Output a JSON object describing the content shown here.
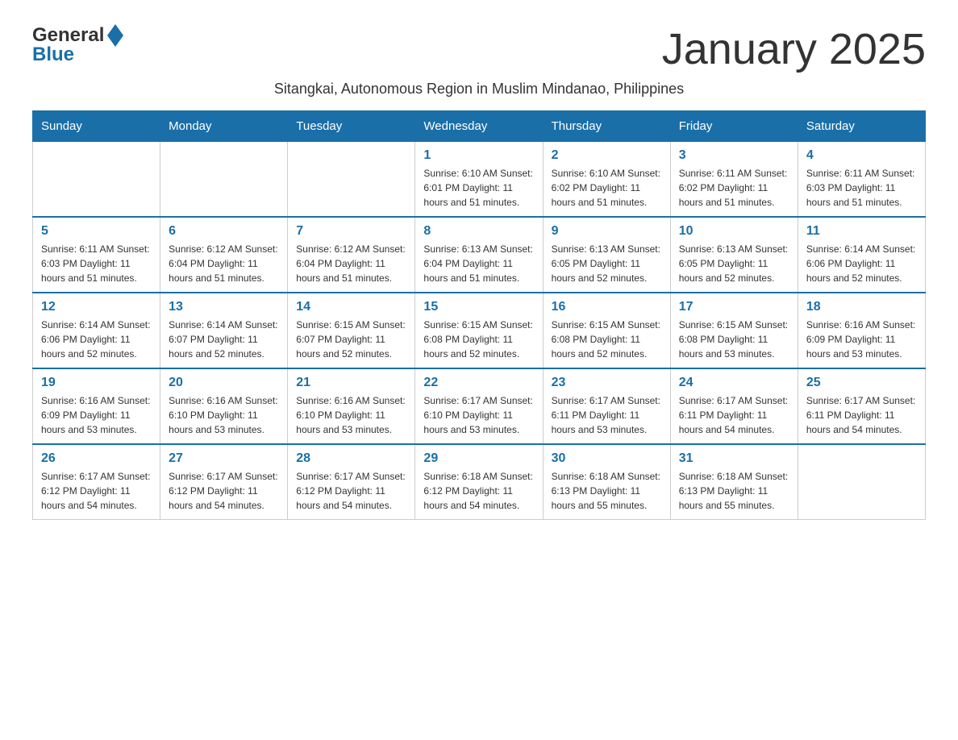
{
  "header": {
    "logo_general": "General",
    "logo_blue": "Blue",
    "month_title": "January 2025",
    "subtitle": "Sitangkai, Autonomous Region in Muslim Mindanao, Philippines"
  },
  "days_of_week": [
    "Sunday",
    "Monday",
    "Tuesday",
    "Wednesday",
    "Thursday",
    "Friday",
    "Saturday"
  ],
  "weeks": [
    [
      {
        "day": "",
        "info": ""
      },
      {
        "day": "",
        "info": ""
      },
      {
        "day": "",
        "info": ""
      },
      {
        "day": "1",
        "info": "Sunrise: 6:10 AM\nSunset: 6:01 PM\nDaylight: 11 hours and 51 minutes."
      },
      {
        "day": "2",
        "info": "Sunrise: 6:10 AM\nSunset: 6:02 PM\nDaylight: 11 hours and 51 minutes."
      },
      {
        "day": "3",
        "info": "Sunrise: 6:11 AM\nSunset: 6:02 PM\nDaylight: 11 hours and 51 minutes."
      },
      {
        "day": "4",
        "info": "Sunrise: 6:11 AM\nSunset: 6:03 PM\nDaylight: 11 hours and 51 minutes."
      }
    ],
    [
      {
        "day": "5",
        "info": "Sunrise: 6:11 AM\nSunset: 6:03 PM\nDaylight: 11 hours and 51 minutes."
      },
      {
        "day": "6",
        "info": "Sunrise: 6:12 AM\nSunset: 6:04 PM\nDaylight: 11 hours and 51 minutes."
      },
      {
        "day": "7",
        "info": "Sunrise: 6:12 AM\nSunset: 6:04 PM\nDaylight: 11 hours and 51 minutes."
      },
      {
        "day": "8",
        "info": "Sunrise: 6:13 AM\nSunset: 6:04 PM\nDaylight: 11 hours and 51 minutes."
      },
      {
        "day": "9",
        "info": "Sunrise: 6:13 AM\nSunset: 6:05 PM\nDaylight: 11 hours and 52 minutes."
      },
      {
        "day": "10",
        "info": "Sunrise: 6:13 AM\nSunset: 6:05 PM\nDaylight: 11 hours and 52 minutes."
      },
      {
        "day": "11",
        "info": "Sunrise: 6:14 AM\nSunset: 6:06 PM\nDaylight: 11 hours and 52 minutes."
      }
    ],
    [
      {
        "day": "12",
        "info": "Sunrise: 6:14 AM\nSunset: 6:06 PM\nDaylight: 11 hours and 52 minutes."
      },
      {
        "day": "13",
        "info": "Sunrise: 6:14 AM\nSunset: 6:07 PM\nDaylight: 11 hours and 52 minutes."
      },
      {
        "day": "14",
        "info": "Sunrise: 6:15 AM\nSunset: 6:07 PM\nDaylight: 11 hours and 52 minutes."
      },
      {
        "day": "15",
        "info": "Sunrise: 6:15 AM\nSunset: 6:08 PM\nDaylight: 11 hours and 52 minutes."
      },
      {
        "day": "16",
        "info": "Sunrise: 6:15 AM\nSunset: 6:08 PM\nDaylight: 11 hours and 52 minutes."
      },
      {
        "day": "17",
        "info": "Sunrise: 6:15 AM\nSunset: 6:08 PM\nDaylight: 11 hours and 53 minutes."
      },
      {
        "day": "18",
        "info": "Sunrise: 6:16 AM\nSunset: 6:09 PM\nDaylight: 11 hours and 53 minutes."
      }
    ],
    [
      {
        "day": "19",
        "info": "Sunrise: 6:16 AM\nSunset: 6:09 PM\nDaylight: 11 hours and 53 minutes."
      },
      {
        "day": "20",
        "info": "Sunrise: 6:16 AM\nSunset: 6:10 PM\nDaylight: 11 hours and 53 minutes."
      },
      {
        "day": "21",
        "info": "Sunrise: 6:16 AM\nSunset: 6:10 PM\nDaylight: 11 hours and 53 minutes."
      },
      {
        "day": "22",
        "info": "Sunrise: 6:17 AM\nSunset: 6:10 PM\nDaylight: 11 hours and 53 minutes."
      },
      {
        "day": "23",
        "info": "Sunrise: 6:17 AM\nSunset: 6:11 PM\nDaylight: 11 hours and 53 minutes."
      },
      {
        "day": "24",
        "info": "Sunrise: 6:17 AM\nSunset: 6:11 PM\nDaylight: 11 hours and 54 minutes."
      },
      {
        "day": "25",
        "info": "Sunrise: 6:17 AM\nSunset: 6:11 PM\nDaylight: 11 hours and 54 minutes."
      }
    ],
    [
      {
        "day": "26",
        "info": "Sunrise: 6:17 AM\nSunset: 6:12 PM\nDaylight: 11 hours and 54 minutes."
      },
      {
        "day": "27",
        "info": "Sunrise: 6:17 AM\nSunset: 6:12 PM\nDaylight: 11 hours and 54 minutes."
      },
      {
        "day": "28",
        "info": "Sunrise: 6:17 AM\nSunset: 6:12 PM\nDaylight: 11 hours and 54 minutes."
      },
      {
        "day": "29",
        "info": "Sunrise: 6:18 AM\nSunset: 6:12 PM\nDaylight: 11 hours and 54 minutes."
      },
      {
        "day": "30",
        "info": "Sunrise: 6:18 AM\nSunset: 6:13 PM\nDaylight: 11 hours and 55 minutes."
      },
      {
        "day": "31",
        "info": "Sunrise: 6:18 AM\nSunset: 6:13 PM\nDaylight: 11 hours and 55 minutes."
      },
      {
        "day": "",
        "info": ""
      }
    ]
  ]
}
